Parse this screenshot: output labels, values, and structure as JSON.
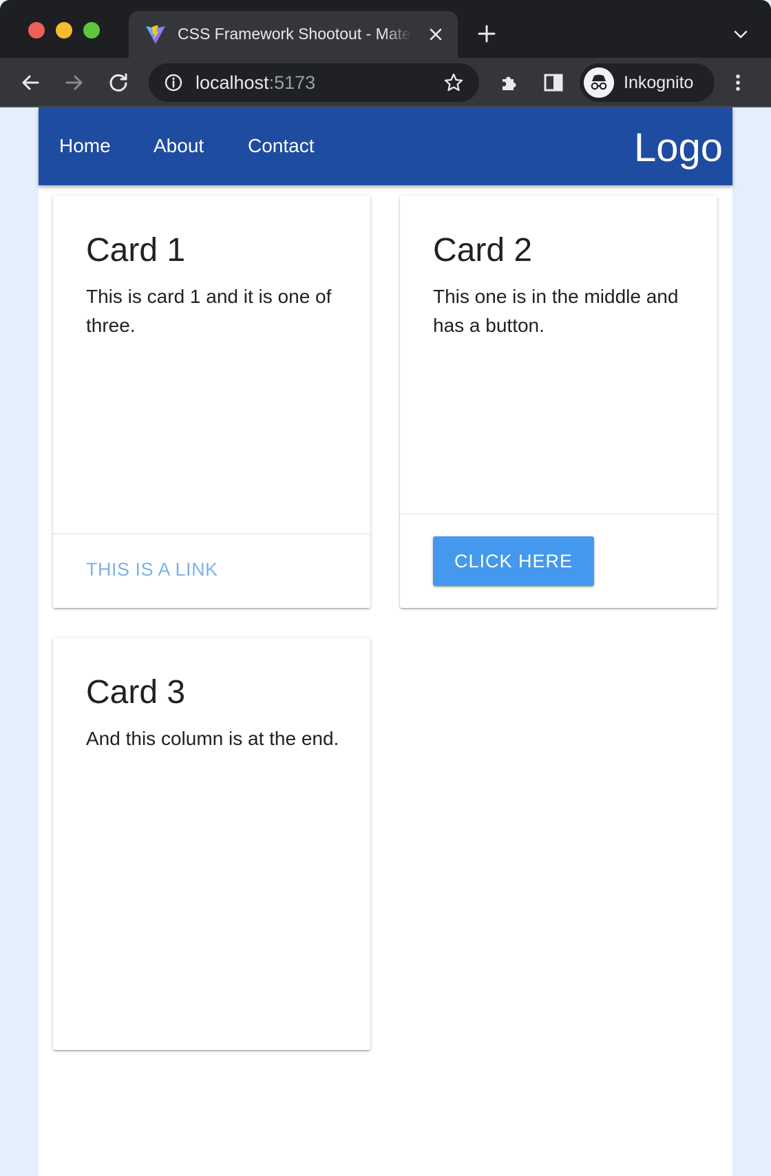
{
  "browser": {
    "tab_title": "CSS Framework Shootout - Materialize",
    "url_host": "localhost",
    "url_port": ":5173",
    "profile_label": "Inkognito",
    "icons": [
      "vite-favicon",
      "close-icon",
      "plus-icon",
      "chevron-down-icon",
      "back-arrow-icon",
      "forward-arrow-icon",
      "reload-icon",
      "info-icon",
      "star-icon",
      "puzzle-icon",
      "sidebar-icon",
      "incognito-icon",
      "kebab-menu-icon"
    ]
  },
  "navbar": {
    "color": "#1e4ca0",
    "links": [
      {
        "label": "Home"
      },
      {
        "label": "About"
      },
      {
        "label": "Contact"
      }
    ],
    "logo": "Logo"
  },
  "cards": [
    {
      "title": "Card 1",
      "text": "This is card 1 and it is one of three.",
      "action_link": "THIS IS A LINK"
    },
    {
      "title": "Card 2",
      "text": "This one is in the middle and has a button.",
      "action_button": "CLICK HERE"
    },
    {
      "title": "Card 3",
      "text": "And this column is at the end."
    }
  ],
  "colors": {
    "link": "#7cb3e8",
    "button": "#4498ee",
    "page_bg": "#e3effb"
  }
}
